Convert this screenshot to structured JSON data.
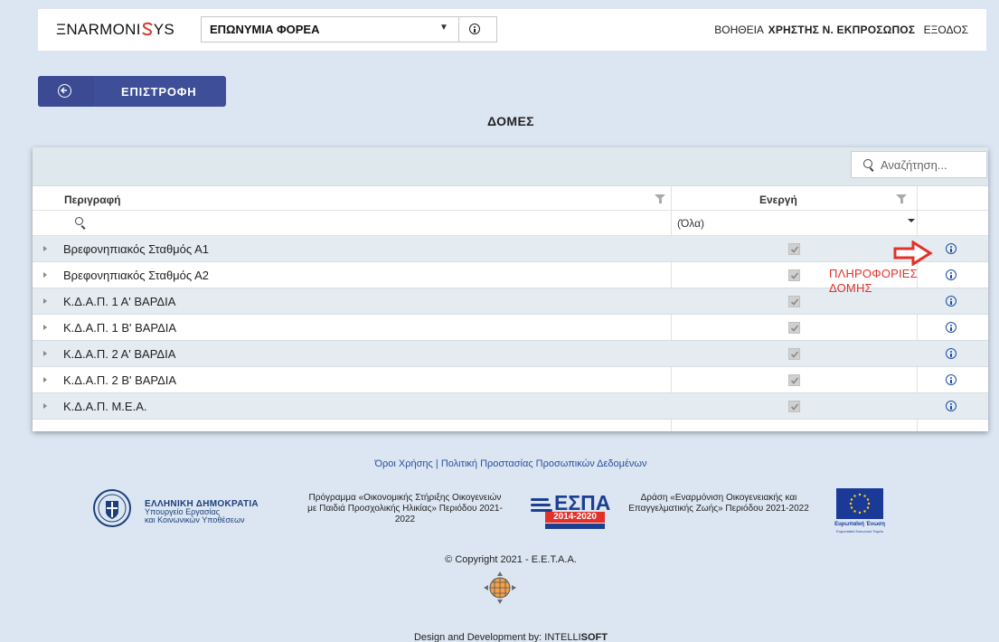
{
  "header": {
    "logo": {
      "pre": "ΞNARMONI",
      "post": "YS"
    },
    "org_select": {
      "value": "ΕΠΩΝΥΜΙΑ ΦΟΡΕΑ"
    },
    "help": "ΒΟΗΘΕΙΑ",
    "user": "ΧΡΗΣΤΗΣ Ν. ΕΚΠΡΟΣΩΠΟΣ",
    "logout": "ΕΞΟΔΟΣ"
  },
  "back_button": {
    "label": "ΕΠΙΣΤΡΟΦΗ"
  },
  "page_title": "ΔΟΜΕΣ",
  "grid": {
    "search_placeholder": "Αναζήτηση...",
    "columns": {
      "description": "Περιγραφή",
      "active": "Ενεργή"
    },
    "filter": {
      "active_value": "(Όλα)"
    },
    "rows": [
      {
        "name": "Βρεφονηπιακός Σταθμός  Α1",
        "active": true
      },
      {
        "name": "Βρεφονηπιακός Σταθμός  Α2",
        "active": true
      },
      {
        "name": "Κ.Δ.Α.Π. 1 Α' ΒΑΡΔΙΑ",
        "active": true
      },
      {
        "name": "Κ.Δ.Α.Π. 1 Β' ΒΑΡΔΙΑ",
        "active": true
      },
      {
        "name": "Κ.Δ.Α.Π. 2 Α' ΒΑΡΔΙΑ",
        "active": true
      },
      {
        "name": "Κ.Δ.Α.Π.  2 Β' ΒΑΡΔΙΑ",
        "active": true
      },
      {
        "name": "Κ.Δ.Α.Π.  Μ.Ε.Α.",
        "active": true
      }
    ]
  },
  "annotation": {
    "text": "ΠΛΗΡΟΦΟΡΙΕΣ ΔΟΜΗΣ",
    "color": "#e3312a"
  },
  "footer": {
    "terms_link": "Όροι Χρήσης",
    "privacy_link": "Πολιτική Προστασίας Προσωπικών Δεδομένων",
    "gov": {
      "title": "ΕΛΛΗΝΙΚΗ ΔΗΜΟΚΡΑΤΙΑ",
      "line1": "Υπουργείο Εργασίας",
      "line2": "και Κοινωνικών Υποθέσεων"
    },
    "program": "Πρόγραμμα «Οικονομικής Στήριξης Οικογενειών με Παιδιά Προσχολικής Ηλικίας» Περιόδου 2021-2022",
    "espa": {
      "word": "ΕΣΠΑ",
      "years": "2014-2020"
    },
    "action": "Δράση «Εναρμόνιση Οικογενειακής και Επαγγελματικής Ζωής» Περιόδου 2021-2022",
    "eu": {
      "line1": "Ευρωπαϊκή Ένωση",
      "line2": "Ευρωπαϊκό Κοινωνικό Ταμείο"
    },
    "copyright": "© Copyright 2021 - Ε.Ε.Τ.Α.Α.",
    "credit_prefix": "Design and Development by:",
    "credit_brand_a": "INTELLI",
    "credit_brand_b": "SOFT"
  },
  "colors": {
    "background": "#dce6f2",
    "back_button": "#3e4e99",
    "info_icon": "#1a4fa3",
    "row_alt": "#e4ecf1"
  }
}
